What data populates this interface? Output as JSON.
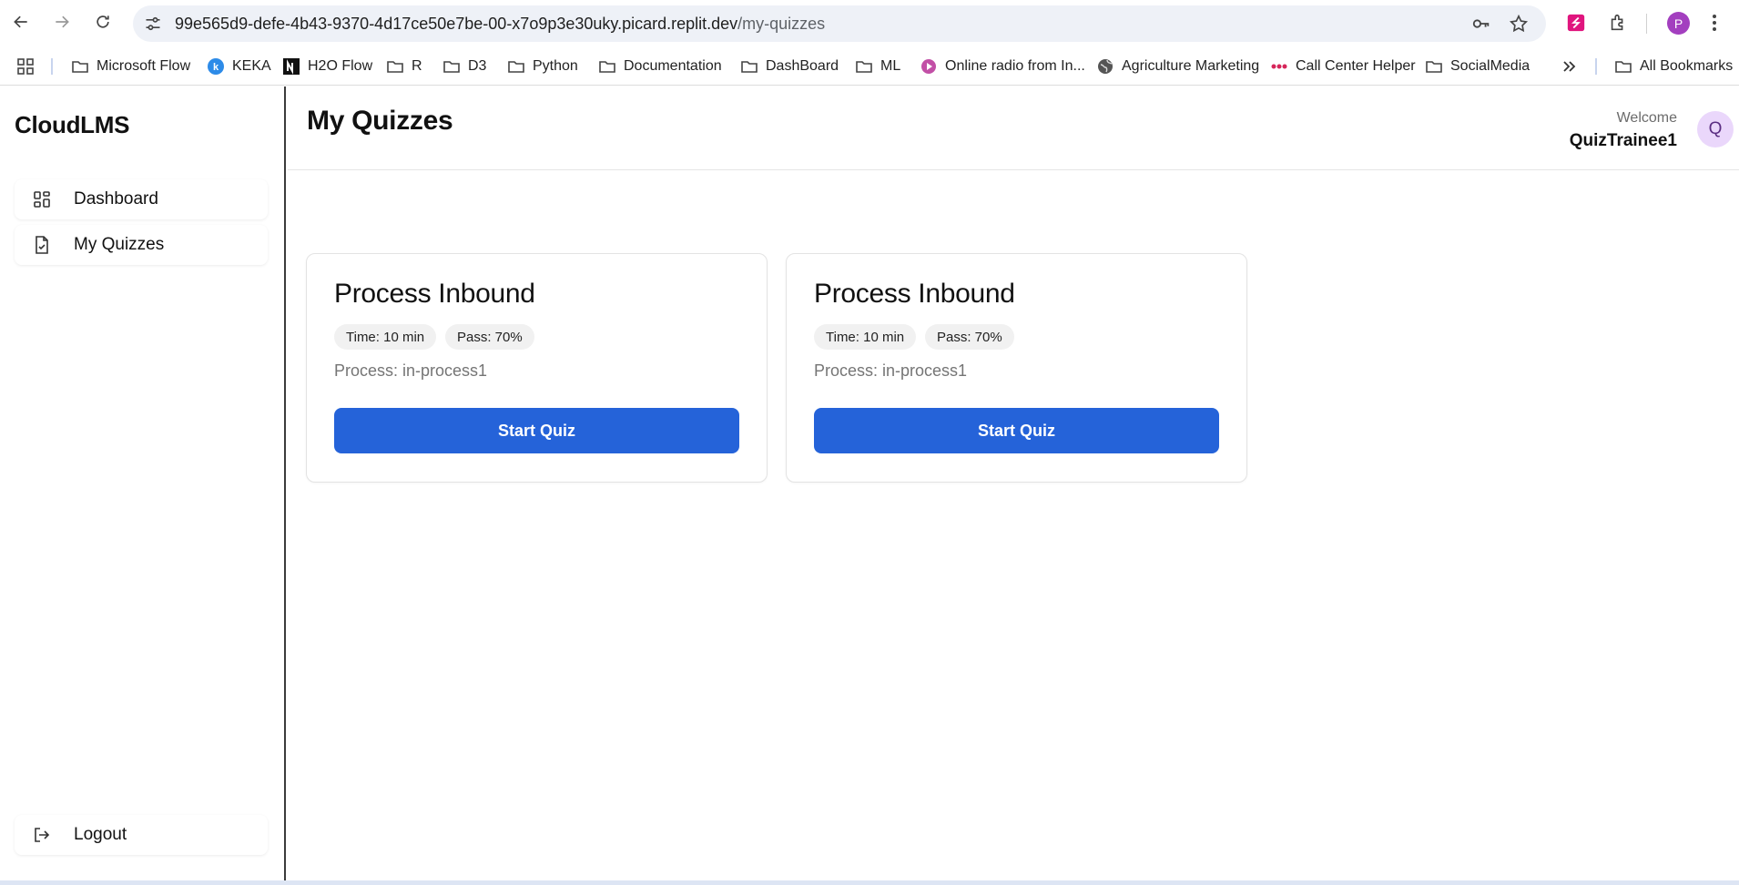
{
  "browser": {
    "url_host": "99e565d9-defe-4b43-9370-4d17ce50e7be-00-x7o9p3e30uky.picard.replit.dev",
    "url_path": "/my-quizzes",
    "profile_initial": "P"
  },
  "bookmarks": [
    {
      "label": "Microsoft Flow",
      "icon": "folder-icon"
    },
    {
      "label": "KEKA",
      "icon": "keka-icon"
    },
    {
      "label": "H2O Flow",
      "icon": "h2o-icon"
    },
    {
      "label": "R",
      "icon": "folder-icon"
    },
    {
      "label": "D3",
      "icon": "folder-icon"
    },
    {
      "label": "Python",
      "icon": "folder-icon"
    },
    {
      "label": "Documentation",
      "icon": "folder-icon"
    },
    {
      "label": "DashBoard",
      "icon": "folder-icon"
    },
    {
      "label": "ML",
      "icon": "folder-icon"
    },
    {
      "label": "Online radio from In...",
      "icon": "radio-icon"
    },
    {
      "label": "Agriculture Marketing",
      "icon": "globe-icon"
    },
    {
      "label": "Call Center Helper",
      "icon": "callcenter-icon"
    },
    {
      "label": "SocialMedia",
      "icon": "folder-icon"
    }
  ],
  "all_bookmarks_label": "All Bookmarks",
  "sidebar": {
    "brand": "CloudLMS",
    "items": [
      {
        "label": "Dashboard",
        "icon": "dashboard-grid-icon"
      },
      {
        "label": "My Quizzes",
        "icon": "file-check-icon"
      }
    ],
    "logout_label": "Logout"
  },
  "header": {
    "welcome_label": "Welcome",
    "username": "QuizTrainee1",
    "avatar_initial": "Q"
  },
  "main": {
    "title": "My Quizzes",
    "quizzes": [
      {
        "title": "Process Inbound",
        "time_badge": "Time: 10 min",
        "pass_badge": "Pass: 70%",
        "process": "Process: in-process1",
        "button": "Start Quiz"
      },
      {
        "title": "Process Inbound",
        "time_badge": "Time: 10 min",
        "pass_badge": "Pass: 70%",
        "process": "Process: in-process1",
        "button": "Start Quiz"
      }
    ]
  },
  "colors": {
    "primary_button": "#2563d9",
    "avatar_bg": "#ead7fb",
    "profile_bg": "#a33fbf"
  }
}
